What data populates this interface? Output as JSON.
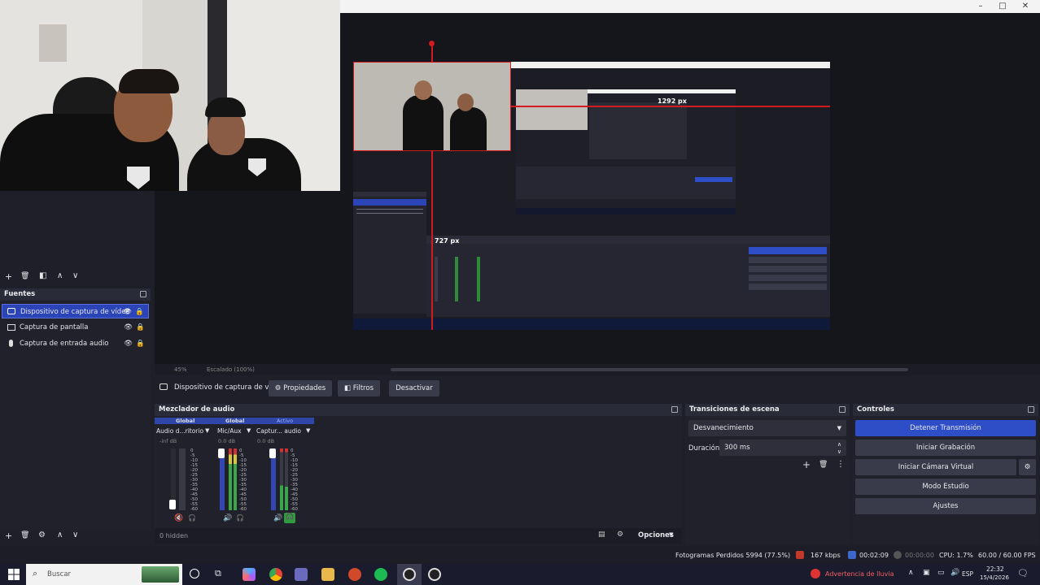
{
  "window": {
    "minimize": "–",
    "maximize": "□",
    "close": "✕"
  },
  "preview": {
    "dim_top": "1292 px",
    "dim_left": "727 px",
    "zoom_label": "45%",
    "scene_label": "Escalado (100%)"
  },
  "sources_toolbar": {
    "add": "+",
    "remove": "🗑",
    "filters": "◧",
    "up": "∧",
    "down": "∨"
  },
  "sources": {
    "title": "Fuentes",
    "items": [
      {
        "label": "Dispositivo de captura de vídeo",
        "icon": "camera-icon",
        "selected": true
      },
      {
        "label": "Captura de pantalla",
        "icon": "monitor-icon",
        "selected": false
      },
      {
        "label": "Captura de entrada audio",
        "icon": "mic-icon",
        "selected": false
      }
    ]
  },
  "source_bar": {
    "selected_source": "Dispositivo de captura de v",
    "properties": "Propiedades",
    "filters": "Filtros",
    "deactivate": "Desactivar"
  },
  "mixer": {
    "title": "Mezclador de audio",
    "channels": [
      {
        "tag": "Global",
        "name": "Audio d...ritorio",
        "db": "-inf dB",
        "muted": true
      },
      {
        "tag": "Global",
        "name": "Mic/Aux",
        "db": "0.0 dB",
        "muted": false
      },
      {
        "tag": "Activo",
        "name": "Captur... audio",
        "db": "0.0 dB",
        "muted": false
      }
    ],
    "scale": [
      "0",
      "-5",
      "-10",
      "-15",
      "-20",
      "-25",
      "-30",
      "-35",
      "-40",
      "-45",
      "-50",
      "-55",
      "-60"
    ],
    "hidden": "0 hidden",
    "options": "Opciones"
  },
  "transitions": {
    "title": "Transiciones de escena",
    "selected": "Desvanecimiento",
    "duration_label": "Duración",
    "duration_value": "300 ms"
  },
  "controls": {
    "title": "Controles",
    "stop_stream": "Detener Transmisión",
    "start_recording": "Iniciar Grabación",
    "virtual_camera": "Iniciar Cámara Virtual",
    "studio_mode": "Modo Estudio",
    "settings": "Ajustes"
  },
  "status": {
    "dropped": "Fotogramas Perdidos 5994 (77.5%)",
    "kbps": "167 kbps",
    "stream_time": "00:02:09",
    "rec_time": "00:00:00",
    "cpu": "CPU: 1.7%",
    "fps": "60.00 / 60.00 FPS"
  },
  "taskbar": {
    "search_placeholder": "Buscar",
    "weather": "Advertencia de lluvia",
    "lang": "ESP",
    "time": "22:32",
    "date": "15/4/2026"
  },
  "colors": {
    "accent": "#2d4ec7",
    "bg": "#1e1f29",
    "panel": "#20212b",
    "red": "#d31a1f"
  }
}
